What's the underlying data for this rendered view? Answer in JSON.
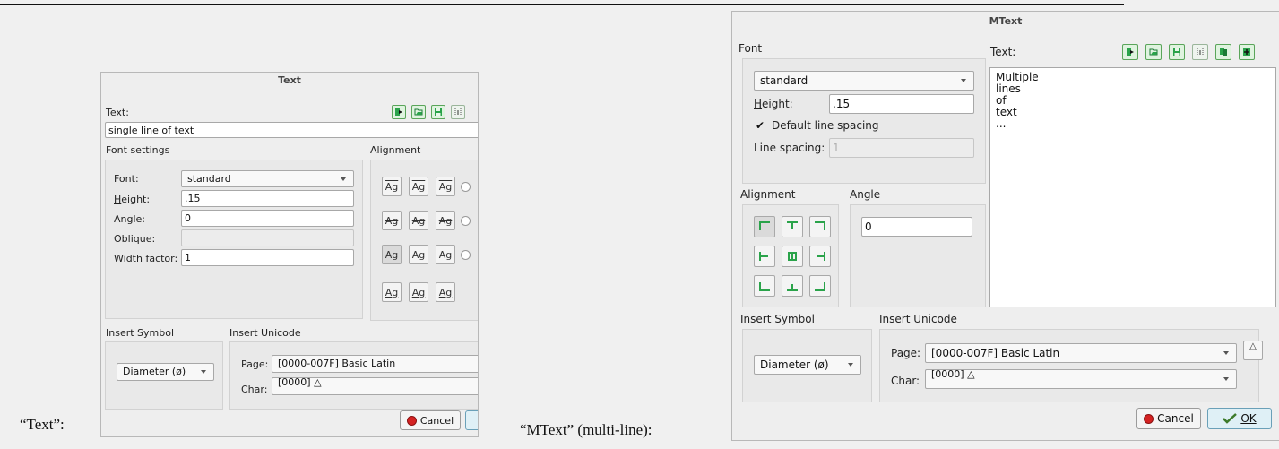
{
  "captions": {
    "text_dialog": "“Text”:",
    "mtext_dialog": "“MText” (multi-line):"
  },
  "text_dialog": {
    "title": "Text",
    "text_label": "Text:",
    "text_value": "single line of text",
    "font_settings_label": "Font settings",
    "alignment_label": "Alignment",
    "font_label": "Font:",
    "font_value": "standard",
    "height_label": "Height:",
    "height_value": ".15",
    "angle_label": "Angle:",
    "angle_value": "0",
    "oblique_label": "Oblique:",
    "oblique_value": "",
    "width_factor_label": "Width factor:",
    "width_factor_value": "1",
    "ag_label": "Ag",
    "insert_symbol_label": "Insert Symbol",
    "insert_unicode_label": "Insert Unicode",
    "symbol_value": "Diameter (ø)",
    "page_label": "Page:",
    "page_value": "[0000-007F] Basic Latin",
    "char_label": "Char:",
    "char_value": "[0000] △",
    "cancel_label": "Cancel"
  },
  "mtext_dialog": {
    "title": "MText",
    "font_label": "Font",
    "text_label": "Text:",
    "font_value": "standard",
    "height_label": "Height:",
    "height_value": ".15",
    "default_spacing_label": "Default line spacing",
    "default_spacing_checked": "✔",
    "line_spacing_label": "Line spacing:",
    "line_spacing_value": "1",
    "alignment_label": "Alignment",
    "angle_label": "Angle",
    "angle_value": "0",
    "text_lines": [
      "Multiple",
      "lines",
      "of",
      "text",
      "..."
    ],
    "insert_symbol_label": "Insert Symbol",
    "insert_unicode_label": "Insert Unicode",
    "symbol_value": "Diameter (ø)",
    "page_label": "Page:",
    "page_value": "[0000-007F] Basic Latin",
    "char_label": "Char:",
    "char_value": "[0000] △",
    "insert_char_symbol": "△",
    "cancel_label": "Cancel",
    "ok_label": "OK"
  },
  "colors": {
    "accent_green": "#2aa34a",
    "cancel_red": "#d42222"
  }
}
